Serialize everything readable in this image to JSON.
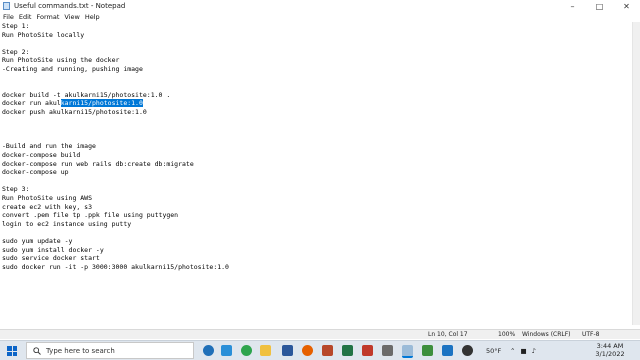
{
  "window": {
    "title": "Useful commands.txt - Notepad"
  },
  "menu": [
    "File",
    "Edit",
    "Format",
    "View",
    "Help"
  ],
  "editor": {
    "lines": [
      "Step 1:",
      "Run PhotoSite locally",
      "",
      "Step 2:",
      "Run PhotoSite using the docker",
      "-Creating and running, pushing image",
      "",
      "",
      "docker build -t akulkarni15/photosite:1.0 .",
      "",
      "docker push akulkarni15/photosite:1.0",
      "",
      "",
      "",
      "-Build and run the image",
      "docker-compose build",
      "docker-compose run web rails db:create db:migrate",
      "docker-compose up",
      "",
      "Step 3:",
      "Run PhotoSite using AWS",
      "create ec2 with key, s3",
      "convert .pem file tp .ppk file using puttygen",
      "login to ec2 instance using putty",
      "",
      "sudo yum update -y",
      "sudo yum install docker -y",
      "sudo service docker start",
      "sudo docker run -it -p 3000:3000 akulkarni15/photosite:1.0"
    ],
    "selected_line": {
      "before": "docker run akul",
      "selected": "karni15/photosite:1.0"
    }
  },
  "status": {
    "position": "Ln 10, Col 17",
    "zoom": "100%",
    "line_ending": "Windows (CRLF)",
    "encoding": "UTF-8"
  },
  "taskbar": {
    "search_placeholder": "Type here to search",
    "weather": "50°F",
    "time": "3:44 AM",
    "date": "3/1/2022"
  },
  "colors": {
    "selection": "#0078d7",
    "taskbar": "#dfe6ee"
  }
}
